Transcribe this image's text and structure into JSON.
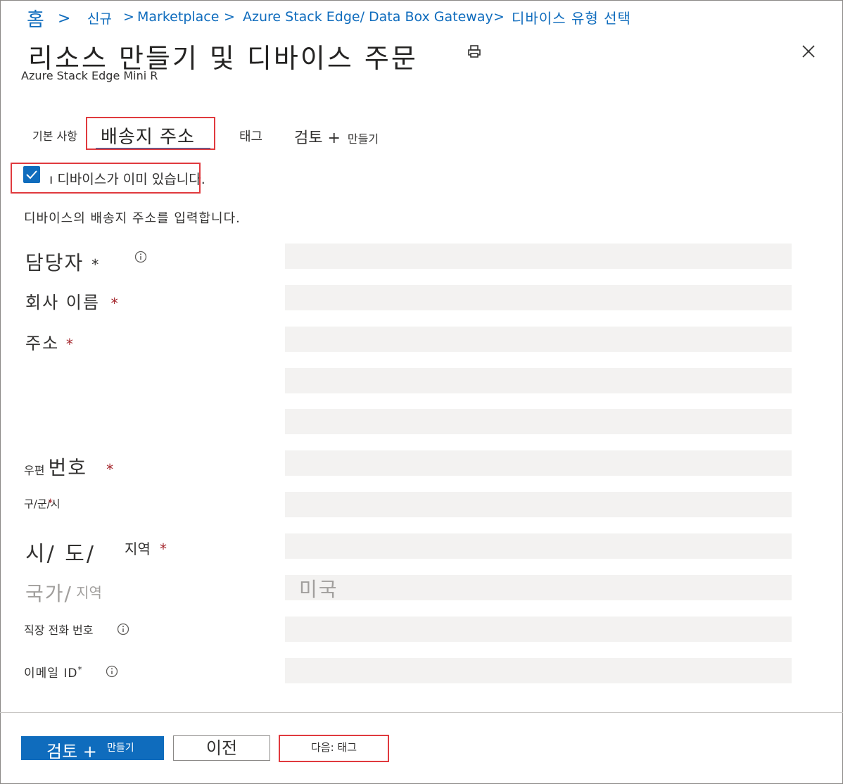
{
  "breadcrumb": {
    "home": "홈",
    "new": "신규",
    "marketplace": "Marketplace",
    "product": "Azure Stack Edge/ Data Box Gateway",
    "current": "디바이스 유형 선택"
  },
  "page": {
    "title": "리소스 만들기 및 디바이스 주문",
    "subtitle": "Azure Stack Edge Mini R"
  },
  "tabs": {
    "basics": "기본 사항",
    "shipping": "배송지 주소",
    "tags": "태그",
    "review": "검토 +",
    "review_suffix": "만들기"
  },
  "checkbox": {
    "checked": true,
    "label": "디바이스가 이미 있습니다."
  },
  "helper_text": "디바이스의 배송지 주소를 입력합니다.",
  "form": {
    "contact": "담당자",
    "company": "회사 이름",
    "address": "주소",
    "postal_a": "우편",
    "postal_b": "번호",
    "city": "구/군/시",
    "state_a": "시/ 도/",
    "state_b": "지역",
    "country_a": "국가/",
    "country_b": "지역",
    "country_value": "미국",
    "phone": "직장 전화 번호",
    "email": "이메일 ID",
    "required_mark": "*"
  },
  "footer": {
    "review_btn": "검토 +",
    "review_btn_suffix": "만들기",
    "prev_btn": "이전",
    "next_btn": "다음: 태그"
  },
  "colors": {
    "accent": "#0f6cbd",
    "highlight": "#e03a3e",
    "required": "#a4262c",
    "field_bg": "#f3f2f1"
  }
}
